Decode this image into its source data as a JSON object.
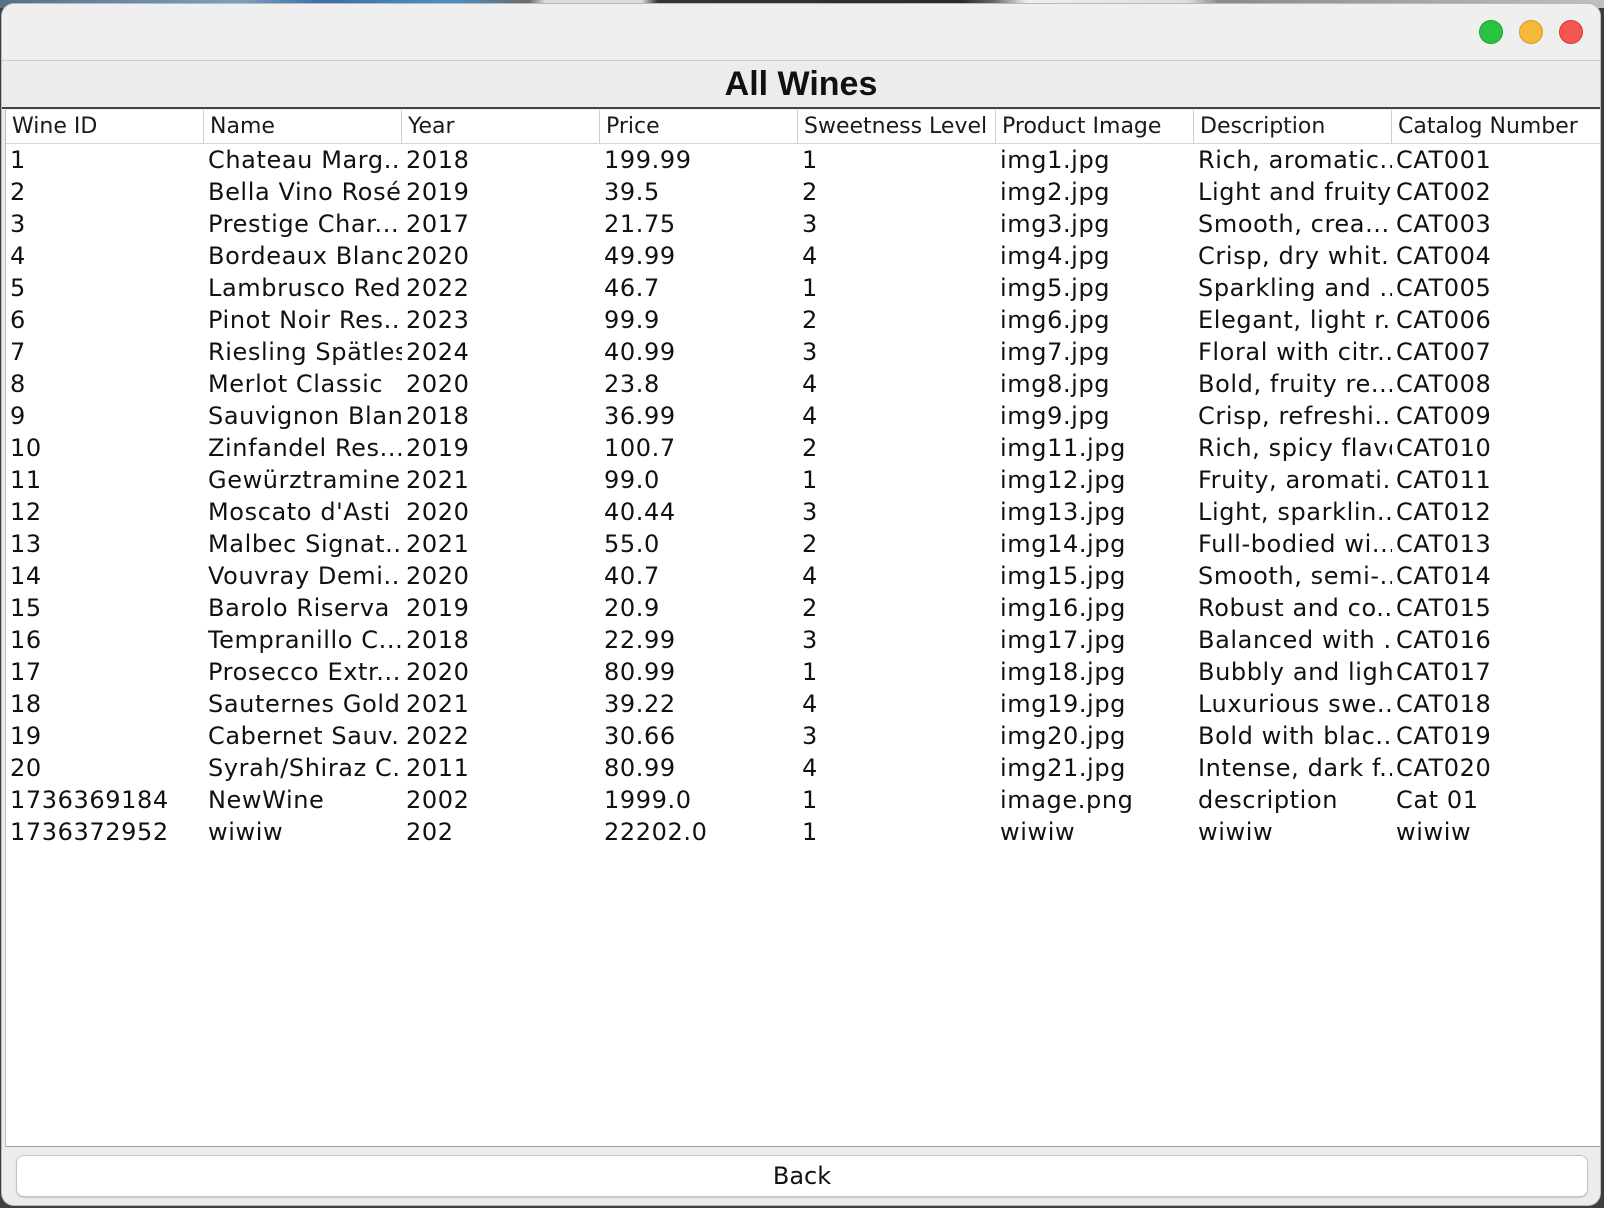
{
  "window": {
    "heading": "All Wines"
  },
  "table": {
    "columns": [
      "Wine ID",
      "Name",
      "Year",
      "Price",
      "Sweetness Level",
      "Product Image",
      "Description",
      "Catalog Number"
    ],
    "rows": [
      [
        "1",
        "Chateau Marg...",
        "2018",
        "199.99",
        "1",
        "img1.jpg",
        "Rich, aromatic...",
        "CAT001"
      ],
      [
        "2",
        "Bella Vino Rosé",
        "2019",
        "39.5",
        "2",
        "img2.jpg",
        "Light and fruity",
        "CAT002"
      ],
      [
        "3",
        "Prestige Char...",
        "2017",
        "21.75",
        "3",
        "img3.jpg",
        "Smooth, crea...",
        "CAT003"
      ],
      [
        "4",
        "Bordeaux Blanc",
        "2020",
        "49.99",
        "4",
        "img4.jpg",
        "Crisp, dry whit...",
        "CAT004"
      ],
      [
        "5",
        "Lambrusco Red",
        "2022",
        "46.7",
        "1",
        "img5.jpg",
        "Sparkling and ...",
        "CAT005"
      ],
      [
        "6",
        "Pinot Noir Res...",
        "2023",
        "99.9",
        "2",
        "img6.jpg",
        "Elegant, light r...",
        "CAT006"
      ],
      [
        "7",
        "Riesling Spätlese",
        "2024",
        "40.99",
        "3",
        "img7.jpg",
        "Floral with citr...",
        "CAT007"
      ],
      [
        "8",
        "Merlot Classic",
        "2020",
        "23.8",
        "4",
        "img8.jpg",
        "Bold, fruity re...",
        "CAT008"
      ],
      [
        "9",
        "Sauvignon Blanc",
        "2018",
        "36.99",
        "4",
        "img9.jpg",
        "Crisp, refreshi...",
        "CAT009"
      ],
      [
        "10",
        " Zinfandel Res...",
        "2019",
        "100.7",
        "2",
        "img11.jpg",
        "Rich, spicy flavor",
        "CAT010"
      ],
      [
        "11",
        "Gewürztraminer",
        "2021",
        "99.0",
        "1",
        "img12.jpg",
        "Fruity, aromati...",
        "CAT011"
      ],
      [
        "12",
        "Moscato d'Asti",
        "2020",
        "40.44",
        "3",
        "img13.jpg",
        "Light, sparklin...",
        "CAT012"
      ],
      [
        "13",
        "Malbec Signat...",
        "2021",
        "55.0",
        "2",
        "img14.jpg",
        "Full-bodied wi...",
        "CAT013"
      ],
      [
        "14",
        "Vouvray Demi...",
        "2020",
        "40.7",
        "4",
        "img15.jpg",
        "Smooth, semi-...",
        "CAT014"
      ],
      [
        "15",
        "Barolo Riserva",
        "2019",
        "20.9",
        "2",
        "img16.jpg",
        "Robust and co...",
        "CAT015"
      ],
      [
        "16",
        "Tempranillo C...",
        "2018",
        "22.99",
        "3",
        "img17.jpg",
        "Balanced with ...",
        "CAT016"
      ],
      [
        "17",
        "Prosecco Extr...",
        "2020",
        "80.99",
        "1",
        "img18.jpg",
        "Bubbly and light",
        "CAT017"
      ],
      [
        "18",
        "Sauternes Gold",
        "2021",
        "39.22",
        "4",
        "img19.jpg",
        "Luxurious swe...",
        "CAT018"
      ],
      [
        "19",
        "Cabernet Sauv...",
        "2022",
        "30.66",
        "3",
        "img20.jpg",
        "Bold with blac...",
        "CAT019"
      ],
      [
        "20",
        "Syrah/Shiraz C...",
        "2011",
        "80.99",
        "4",
        "img21.jpg",
        "Intense, dark f...",
        "CAT020"
      ],
      [
        "1736369184",
        "NewWine",
        "2002",
        "1999.0",
        "1",
        "image.png",
        "description",
        "Cat 01"
      ],
      [
        "1736372952",
        "wiwiw",
        "202",
        "22202.0",
        "1",
        "wiwiw",
        "wiwiw",
        "wiwiw"
      ]
    ]
  },
  "footer": {
    "back_label": "Back"
  },
  "colors": {
    "close": "#f0574f",
    "minimize": "#f5b83a",
    "zoom": "#29c33f"
  }
}
